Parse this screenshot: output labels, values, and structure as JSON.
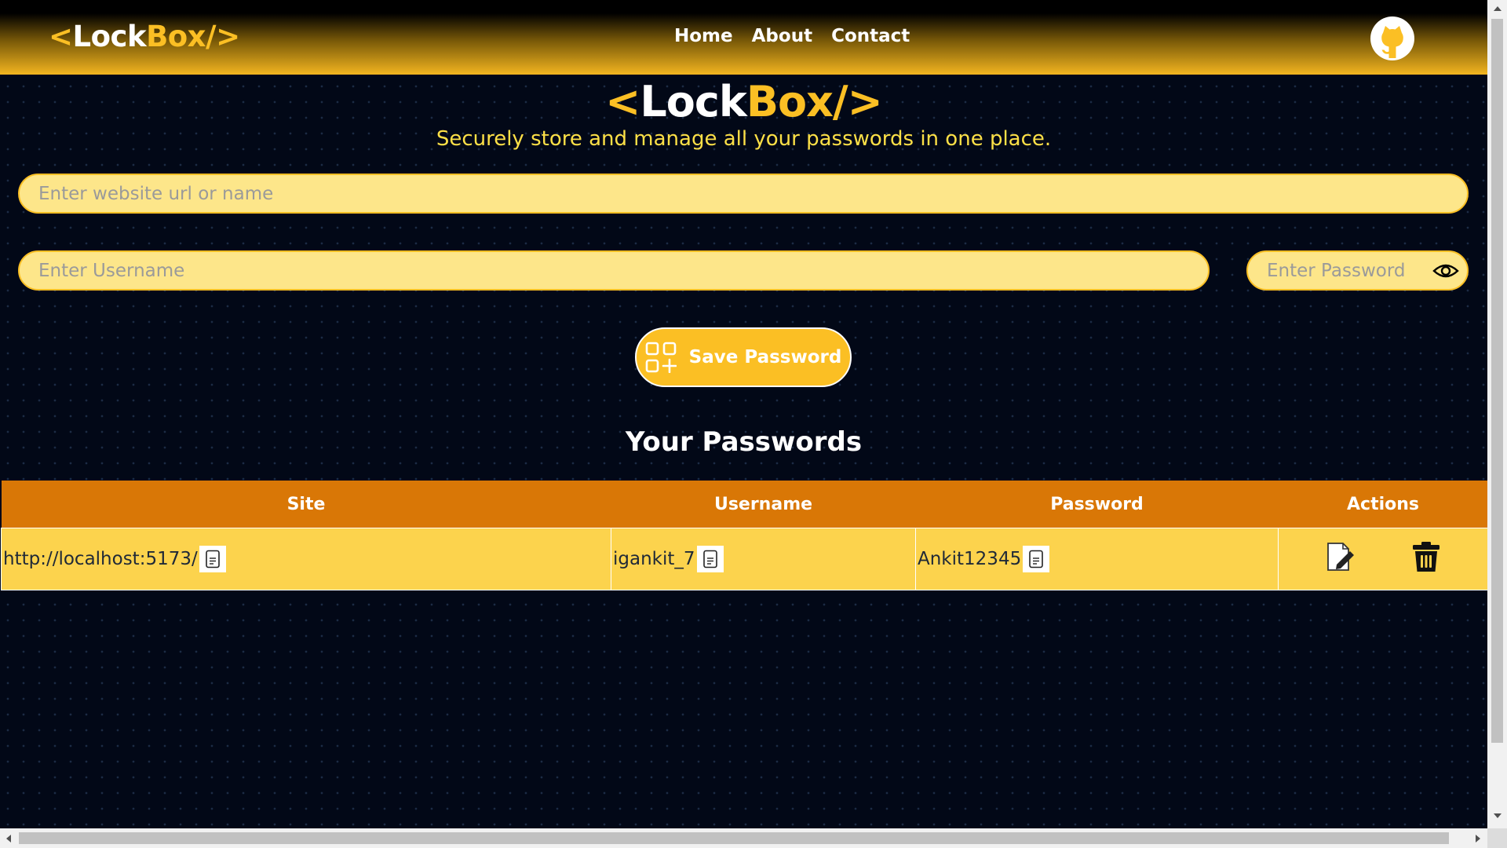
{
  "navbar": {
    "logo": {
      "lt": "<",
      "lock": "Lock",
      "box": "Box/",
      "gt": ">"
    },
    "links": [
      {
        "label": "Home"
      },
      {
        "label": "About"
      },
      {
        "label": "Contact"
      }
    ],
    "github_icon": "github-icon"
  },
  "hero": {
    "title": {
      "lt": "<",
      "lock": "Lock",
      "box": "Box/",
      "gt": ">"
    },
    "tagline": "Securely store and manage all your passwords in one place."
  },
  "form": {
    "site_placeholder": "Enter website url or name",
    "site_value": "",
    "username_placeholder": "Enter Username",
    "username_value": "",
    "password_placeholder": "Enter Password",
    "password_value": "",
    "toggle_icon": "eye-icon",
    "save_label": "Save Password",
    "save_icon": "add-grid-icon"
  },
  "passwords": {
    "title": "Your Passwords",
    "columns": [
      "Site",
      "Username",
      "Password",
      "Actions"
    ],
    "rows": [
      {
        "site": "http://localhost:5173/",
        "username": "igankit_7",
        "password": "Ankit12345"
      }
    ],
    "icons": {
      "copy": "copy-icon",
      "edit": "edit-icon",
      "delete": "trash-icon"
    }
  },
  "colors": {
    "background": "#020817",
    "accent": "#fbbf24",
    "input_bg": "#fde68a",
    "table_header": "#d97706",
    "table_row": "#fcd34d",
    "tagline": "#fde047"
  }
}
